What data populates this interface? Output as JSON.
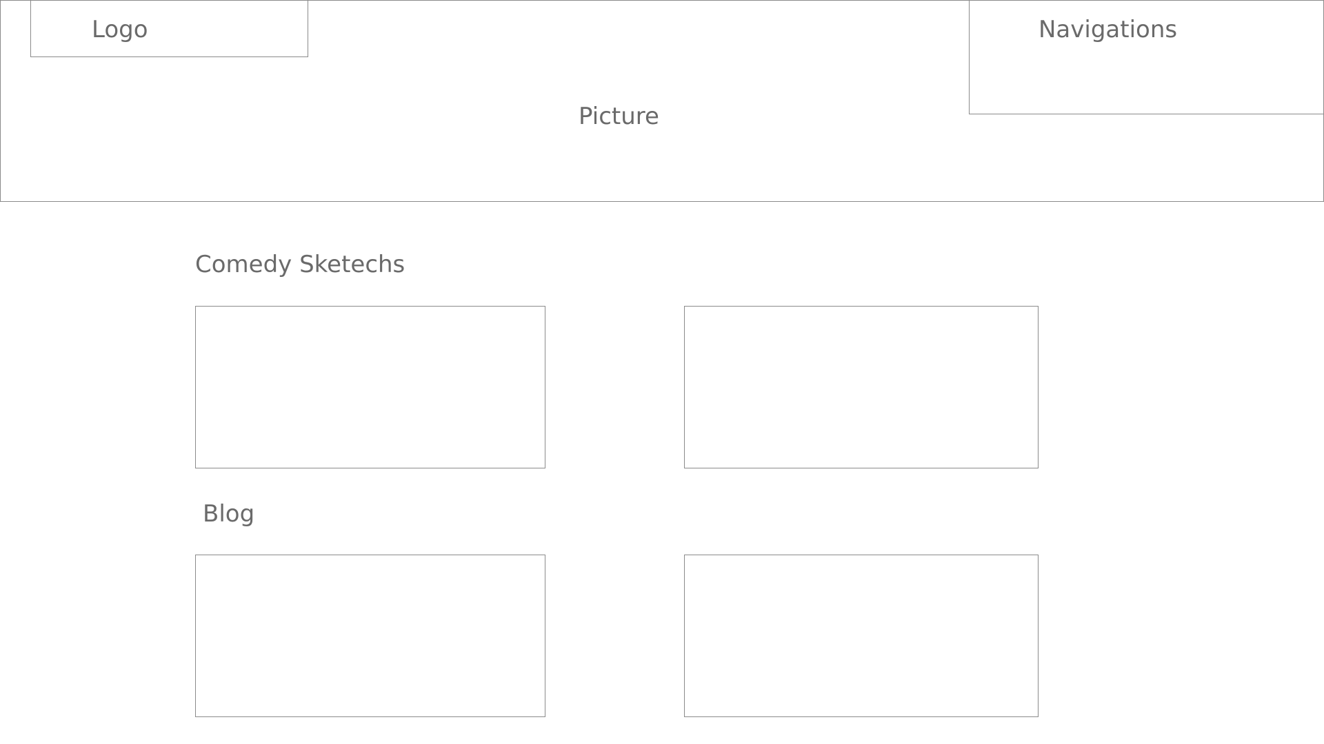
{
  "header": {
    "picture_label": "Picture",
    "logo_label": "Logo",
    "navigation_label": "Navigations"
  },
  "sections": {
    "comedy": {
      "heading": "Comedy Sketechs"
    },
    "blog": {
      "heading": "Blog"
    }
  },
  "colors": {
    "border": "#8a8a8a",
    "text": "#6a6a6a",
    "background": "#ffffff"
  }
}
